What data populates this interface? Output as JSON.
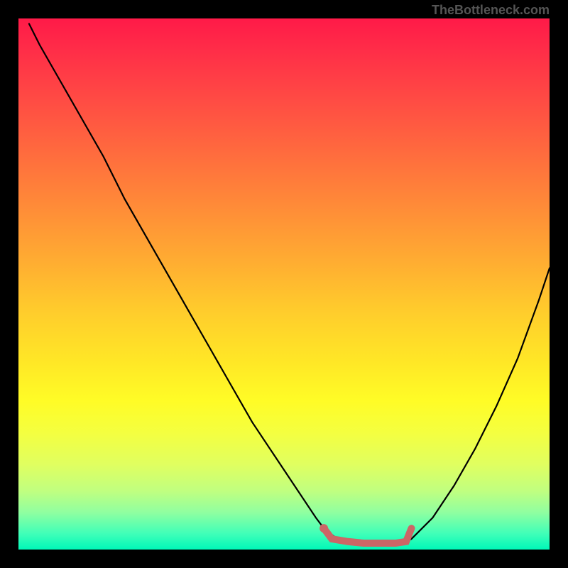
{
  "attribution": "TheBottleneck.com",
  "chart_data": {
    "type": "line",
    "title": "",
    "xlabel": "",
    "ylabel": "",
    "xlim": [
      0,
      100
    ],
    "ylim": [
      0,
      100
    ],
    "series": [
      {
        "name": "bottleneck-curve",
        "color": "#000000",
        "x": [
          2,
          4,
          8,
          12,
          16,
          20,
          24,
          28,
          32,
          36,
          40,
          44,
          48,
          52,
          56,
          57.5,
          60,
          64,
          68,
          72,
          74,
          78,
          82,
          86,
          90,
          94,
          98,
          100
        ],
        "values": [
          99,
          95,
          88,
          81,
          74,
          66,
          59,
          52,
          45,
          38,
          31,
          24,
          18,
          12,
          6,
          4,
          2,
          1,
          1,
          1,
          2,
          6,
          12,
          19,
          27,
          36,
          47,
          53
        ]
      },
      {
        "name": "highlight-segment",
        "color": "#cc6666",
        "x": [
          57.5,
          59,
          62,
          65,
          68,
          71,
          73,
          74
        ],
        "values": [
          4,
          2,
          1.5,
          1.2,
          1.2,
          1.2,
          1.5,
          4
        ]
      }
    ],
    "highlight_dot": {
      "x": 57.5,
      "y": 4,
      "color": "#cc6666"
    }
  }
}
